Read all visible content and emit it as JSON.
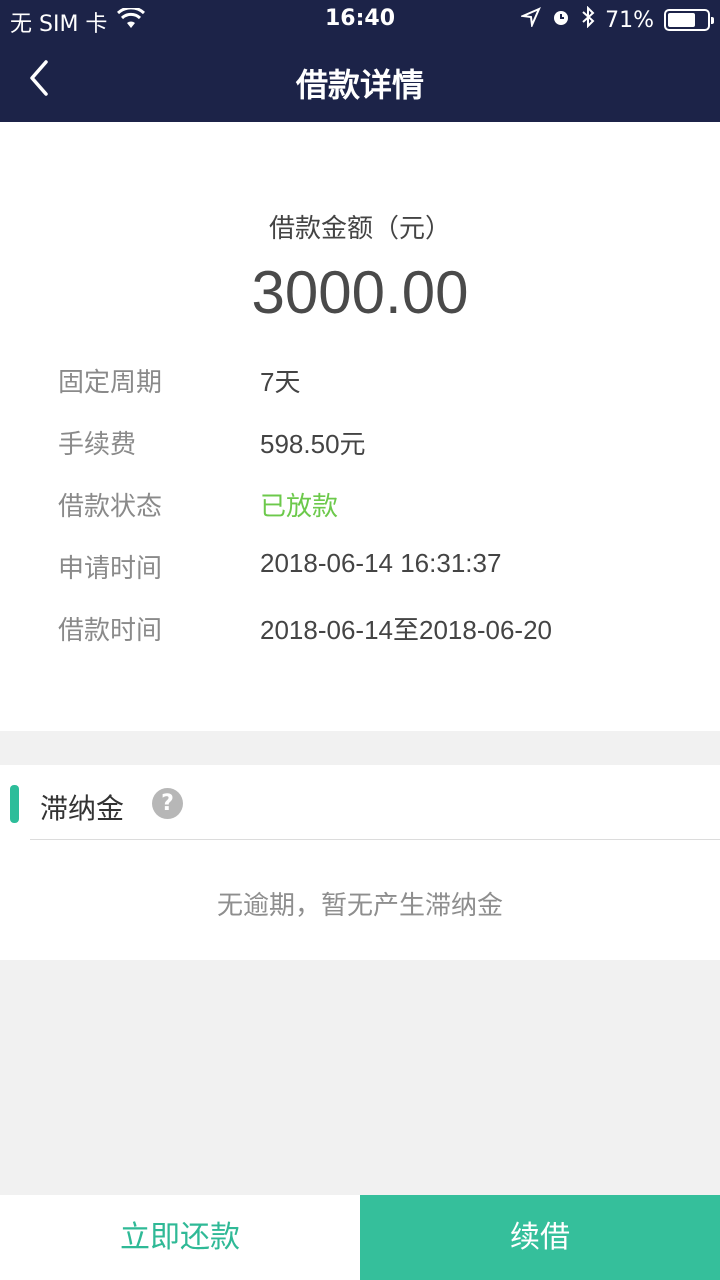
{
  "status_bar": {
    "carrier": "无 SIM 卡",
    "time": "16:40",
    "battery": "71%",
    "battery_level": 0.71,
    "icons": [
      "wifi-icon",
      "location-icon",
      "alarm-icon",
      "bluetooth-icon",
      "battery-icon"
    ]
  },
  "navbar": {
    "title": "借款详情",
    "back_icon": "chevron-left-icon"
  },
  "loan": {
    "amount_label": "借款金额（元）",
    "amount": "3000.00",
    "rows": [
      {
        "label": "固定周期",
        "value": "7天"
      },
      {
        "label": "手续费",
        "value": "598.50元"
      },
      {
        "label": "借款状态",
        "value": "已放款"
      },
      {
        "label": "申请时间",
        "value": "2018-06-14 16:31:37"
      },
      {
        "label": "借款时间",
        "value": "2018-06-14至2018-06-20"
      }
    ]
  },
  "late_fee": {
    "title": "滞纳金",
    "help_icon": "question-icon",
    "help_glyph": "?",
    "empty_text": "无逾期，暂无产生滞纳金"
  },
  "actions": {
    "repay_label": "立即还款",
    "renew_label": "续借"
  },
  "colors": {
    "header_bg": "#1c2348",
    "accent": "#35bf9b",
    "status_green": "#6cc94b"
  }
}
